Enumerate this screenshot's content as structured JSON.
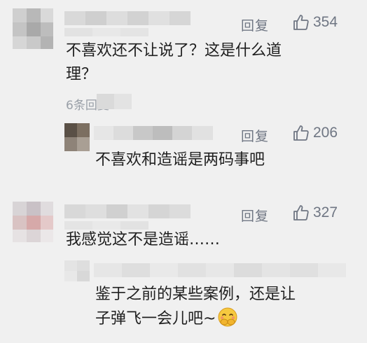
{
  "comments": [
    {
      "reply_label": "回复",
      "likes": "354",
      "text_line1": "不喜欢还不让说了？这是什么道",
      "text_line2": "理？",
      "sub_count": "6条回复",
      "replies": [
        {
          "reply_label": "回复",
          "likes": "206",
          "text": "不喜欢和造谣是两码事吧"
        }
      ]
    },
    {
      "reply_label": "回复",
      "likes": "327",
      "text": "我感觉这不是造谣……",
      "replies": [
        {
          "text_line1": "鉴于之前的某些案例，还是让",
          "text_line2": "子弹飞一会儿吧~",
          "emoji": "face-with-hands-over-mouth-emoji"
        }
      ]
    }
  ],
  "colors": {
    "background": "#f0f0f0",
    "text": "#1f1f1f",
    "secondary": "#6f7683",
    "mosaic": "#d4d4d4"
  }
}
